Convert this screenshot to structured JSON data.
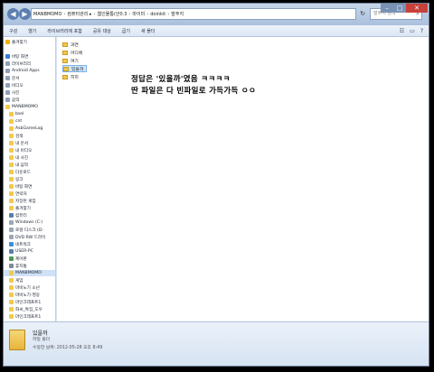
{
  "address": {
    "crumbs": [
      "MANBMOMO",
      "컴퓨터관리 ▸",
      "웹인물통(안0.3",
      "마이미",
      "doinkit",
      "발주지"
    ]
  },
  "search": {
    "placeholder": "발주지 검색"
  },
  "toolbar": {
    "organize": "구성",
    "open": "열기",
    "include_library": "라이브러리에 포함",
    "share": "공유 대상",
    "burn": "굽기",
    "new_folder": "새 폴더"
  },
  "navpane": {
    "items": [
      {
        "label": "즐겨찾기",
        "kind": "star"
      },
      {
        "label": "",
        "kind": "none"
      },
      {
        "label": "바탕 화면",
        "kind": "desktop"
      },
      {
        "label": "라이브러리",
        "kind": "lib"
      },
      {
        "label": "Android Apps",
        "kind": "lib"
      },
      {
        "label": "문서",
        "kind": "lib"
      },
      {
        "label": "비디오",
        "kind": "lib"
      },
      {
        "label": "사진",
        "kind": "lib"
      },
      {
        "label": "음악",
        "kind": "lib"
      },
      {
        "label": "MANBMOMO",
        "kind": "user"
      },
      {
        "label": "bsel",
        "kind": "folder"
      },
      {
        "label": "cnt",
        "kind": "folder"
      },
      {
        "label": "AsbGameLog",
        "kind": "folder"
      },
      {
        "label": "검색",
        "kind": "folder"
      },
      {
        "label": "내 문서",
        "kind": "folder"
      },
      {
        "label": "내 비디오",
        "kind": "folder"
      },
      {
        "label": "내 사진",
        "kind": "folder"
      },
      {
        "label": "내 음악",
        "kind": "folder"
      },
      {
        "label": "다운로드",
        "kind": "folder"
      },
      {
        "label": "링크",
        "kind": "folder"
      },
      {
        "label": "바탕 화면",
        "kind": "folder"
      },
      {
        "label": "연락처",
        "kind": "folder"
      },
      {
        "label": "저장된 게임",
        "kind": "folder"
      },
      {
        "label": "즐겨찾기",
        "kind": "folder"
      },
      {
        "label": "컴퓨터",
        "kind": "pc"
      },
      {
        "label": "Windows (C:)",
        "kind": "drive"
      },
      {
        "label": "로컬 디스크 (D:",
        "kind": "drive"
      },
      {
        "label": "DVD RW 드라이",
        "kind": "drive"
      },
      {
        "label": "네트워크",
        "kind": "net"
      },
      {
        "label": "USER-PC",
        "kind": "pc"
      },
      {
        "label": "제어판",
        "kind": "cp"
      },
      {
        "label": "휴지통",
        "kind": "bin"
      },
      {
        "label": "MANBMOMO",
        "kind": "folder",
        "selected": true
      },
      {
        "label": "게임",
        "kind": "folder"
      },
      {
        "label": "마비노기 소넌",
        "kind": "folder"
      },
      {
        "label": "마비노기-영웅",
        "kind": "folder"
      },
      {
        "label": "마인크래프트1",
        "kind": "folder"
      },
      {
        "label": "화씨_특집_도우",
        "kind": "folder"
      },
      {
        "label": "마인크래프트1",
        "kind": "folder"
      }
    ]
  },
  "files": [
    {
      "name": "과연"
    },
    {
      "name": "어디에"
    },
    {
      "name": "여기"
    },
    {
      "name": "있을까",
      "selected": true
    },
    {
      "name": "히히"
    }
  ],
  "message": {
    "line1": "정답은 '있을까'였음 ㅋㅋㅋㅋ",
    "line2": "딴 파일은 다 빈파일로 가득가득 ㅇㅇ"
  },
  "details": {
    "name": "있을까",
    "type": "파일 폴더",
    "modified": "수정한 날짜: 2012-05-28 오후 8:49"
  },
  "colors": {
    "folder": "#f2c94c",
    "selection": "#cde6fb",
    "chrome": "#d9e4f1"
  }
}
